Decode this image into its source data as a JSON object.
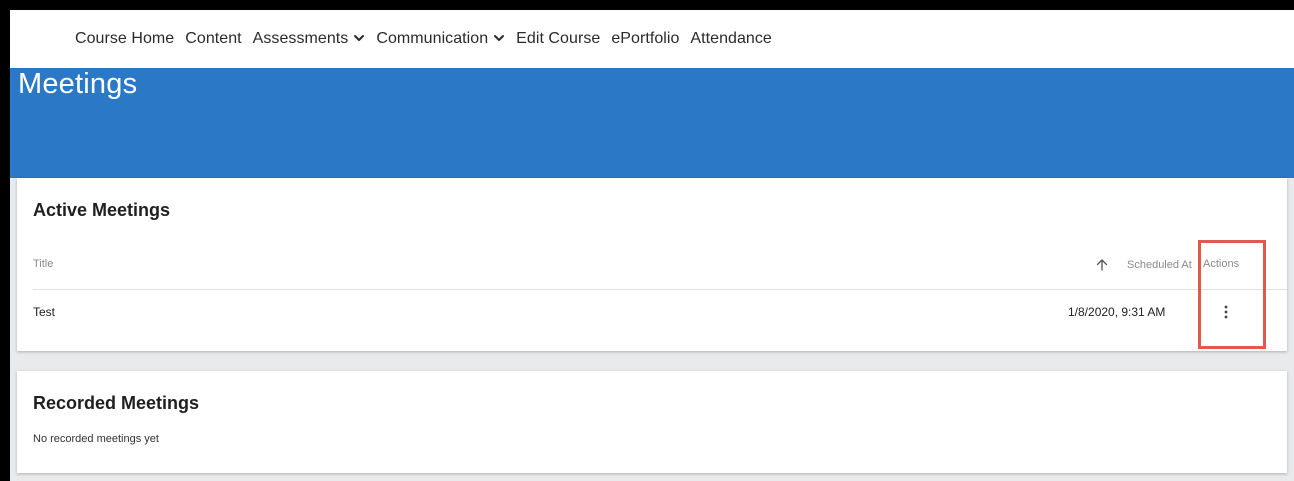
{
  "nav": {
    "items": [
      {
        "label": "Course Home",
        "dropdown": false
      },
      {
        "label": "Content",
        "dropdown": false
      },
      {
        "label": "Assessments",
        "dropdown": true
      },
      {
        "label": "Communication",
        "dropdown": true
      },
      {
        "label": "Edit Course",
        "dropdown": false
      },
      {
        "label": "ePortfolio",
        "dropdown": false
      },
      {
        "label": "Attendance",
        "dropdown": false
      }
    ]
  },
  "page": {
    "title": "Meetings"
  },
  "active_meetings": {
    "title": "Active Meetings",
    "columns": {
      "title": "Title",
      "scheduled": "Scheduled At",
      "actions": "Actions"
    },
    "rows": [
      {
        "title": "Test",
        "scheduled": "1/8/2020, 9:31 AM"
      }
    ]
  },
  "recorded_meetings": {
    "title": "Recorded Meetings",
    "empty_text": "No recorded meetings yet"
  },
  "colors": {
    "banner": "#2a78c6",
    "highlight": "#e05a4e"
  },
  "icons": {
    "dropdown": "chevron-down-icon",
    "sort": "arrow-up-icon",
    "actions": "more-vertical-icon"
  }
}
